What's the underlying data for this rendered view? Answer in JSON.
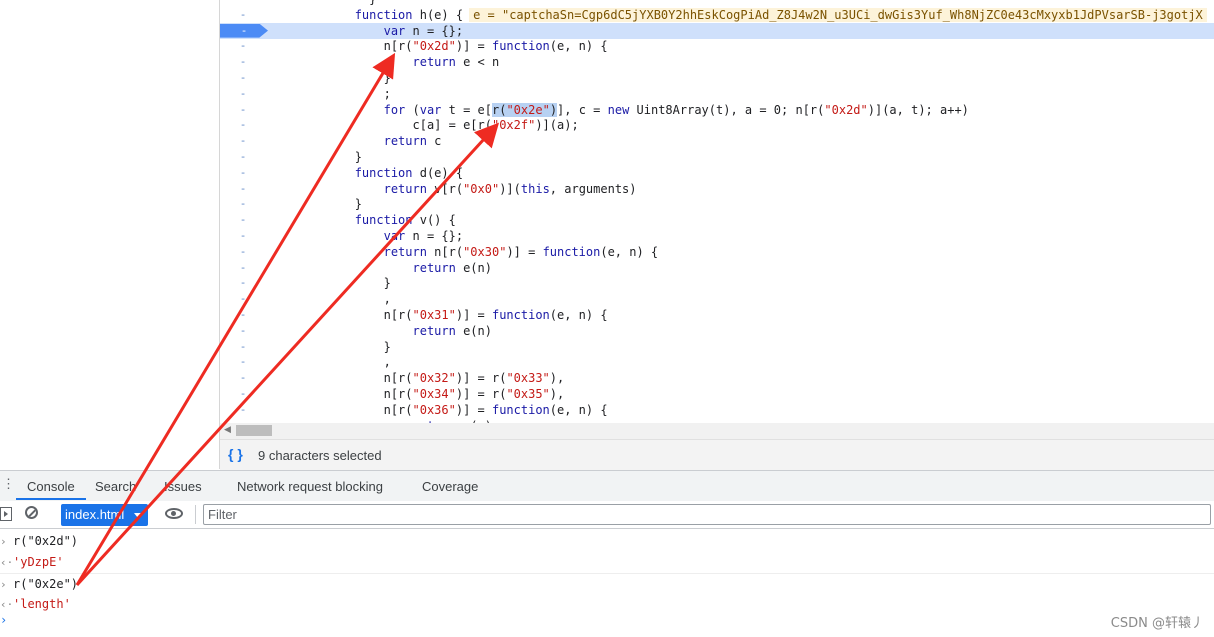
{
  "editor": {
    "lines": [
      {
        "marker": "",
        "html": "<span class=\"kw\">    </span>          }"
      },
      {
        "marker": "-",
        "html": "            <span class=\"kw\">function</span> h(e) {<span class=\"hint\">e = \"captchaSn=Cgp6dC5jYXB0Y2hhEskCogPiAd_Z8J4w2N_u3UCi_dwGis3Yuf_Wh8NjZC0e43cMxyxb1JdPVsarSB-j3gotjX</span>"
      },
      {
        "marker": "-",
        "html": "                <span class=\"kw\">var</span> n = {};",
        "current": true
      },
      {
        "marker": "-",
        "html": "                n[r(<span class=\"str\">\"0x2d\"</span>)] = <span class=\"kw\">function</span>(e, n) {"
      },
      {
        "marker": "-",
        "html": "                    <span class=\"kw\">return</span> e &lt; n"
      },
      {
        "marker": "-",
        "html": "                }"
      },
      {
        "marker": "-",
        "html": "                ;"
      },
      {
        "marker": "-",
        "html": "                <span class=\"kw\">for</span> (<span class=\"kw\">var</span> t = e[<span class=\"sel\">r(<span class=\"str\">\"0x2e\"</span>)</span>], c = <span class=\"kw\">new</span> Uint8Array(t), a = 0; n[r(<span class=\"str\">\"0x2d\"</span>)](a, t); a++)"
      },
      {
        "marker": "-",
        "html": "                    c[a] = e[r(<span class=\"str\">\"0x2f\"</span>)](a);"
      },
      {
        "marker": "-",
        "html": "                <span class=\"kw\">return</span> c"
      },
      {
        "marker": "-",
        "html": "            }"
      },
      {
        "marker": "-",
        "html": "            <span class=\"kw\">function</span> d(e) {"
      },
      {
        "marker": "-",
        "html": "                <span class=\"kw\">return</span> v[r(<span class=\"str\">\"0x0\"</span>)](<span class=\"kw\">this</span>, arguments)"
      },
      {
        "marker": "-",
        "html": "            }"
      },
      {
        "marker": "-",
        "html": "            <span class=\"kw\">function</span> v() {"
      },
      {
        "marker": "-",
        "html": "                <span class=\"kw\">var</span> n = {};"
      },
      {
        "marker": "-",
        "html": "                <span class=\"kw\">return</span> n[r(<span class=\"str\">\"0x30\"</span>)] = <span class=\"kw\">function</span>(e, n) {"
      },
      {
        "marker": "-",
        "html": "                    <span class=\"kw\">return</span> e(n)"
      },
      {
        "marker": "-",
        "html": "                }"
      },
      {
        "marker": "-",
        "html": "                ,"
      },
      {
        "marker": "-",
        "html": "                n[r(<span class=\"str\">\"0x31\"</span>)] = <span class=\"kw\">function</span>(e, n) {"
      },
      {
        "marker": "-",
        "html": "                    <span class=\"kw\">return</span> e(n)"
      },
      {
        "marker": "-",
        "html": "                }"
      },
      {
        "marker": "-",
        "html": "                ,"
      },
      {
        "marker": "-",
        "html": "                n[r(<span class=\"str\">\"0x32\"</span>)] = r(<span class=\"str\">\"0x33\"</span>),"
      },
      {
        "marker": "-",
        "html": "                n[r(<span class=\"str\">\"0x34\"</span>)] = r(<span class=\"str\">\"0x35\"</span>),"
      },
      {
        "marker": "-",
        "html": "                n[r(<span class=\"str\">\"0x36\"</span>)] = <span class=\"kw\">function</span>(e, n) {"
      },
      {
        "marker": "-",
        "html": "                    <span class=\"kw\">return</span> e(n)"
      }
    ]
  },
  "status_bar": {
    "braces_icon": "{ }",
    "text": "9 characters selected"
  },
  "drawer": {
    "kebab_icon": "⋮",
    "tabs": [
      "Console",
      "Search",
      "Issues",
      "Network request blocking",
      "Coverage"
    ]
  },
  "console_toolbar": {
    "context_value": "index.html",
    "filter_placeholder": "Filter"
  },
  "console": {
    "input_icon": "›",
    "result_icon": "‹·",
    "prompt_icon": "›",
    "rows": [
      {
        "kind": "input",
        "text": "r(\"0x2d\")"
      },
      {
        "kind": "result",
        "text": "'yDzpE'"
      },
      {
        "kind": "input",
        "text": "r(\"0x2e\")"
      },
      {
        "kind": "result",
        "text": "'length'"
      }
    ]
  },
  "watermark": "CSDN @轩辕丿",
  "colors": {
    "accent": "#1a73e8",
    "annotation_arrow": "#ee2b22",
    "current_line": "#cfe0fb"
  }
}
